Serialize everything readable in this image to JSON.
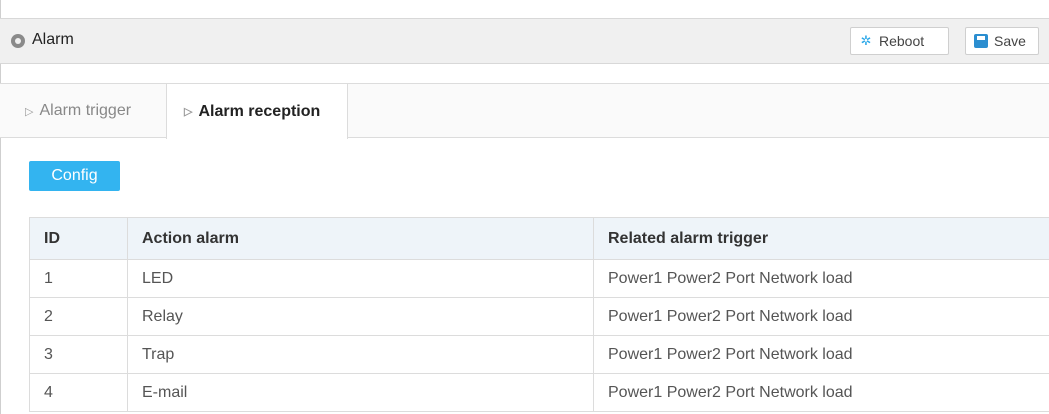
{
  "header": {
    "title": "Alarm",
    "reboot_label": "Reboot",
    "save_label": "Save"
  },
  "tabs": [
    {
      "label": "Alarm trigger",
      "active": false
    },
    {
      "label": "Alarm reception",
      "active": true
    }
  ],
  "config_label": "Config",
  "table": {
    "columns": [
      "ID",
      "Action alarm",
      "Related alarm trigger"
    ],
    "rows": [
      {
        "id": "1",
        "action": "LED",
        "trigger": "Power1 Power2 Port Network load"
      },
      {
        "id": "2",
        "action": "Relay",
        "trigger": "Power1 Power2 Port Network load"
      },
      {
        "id": "3",
        "action": "Trap",
        "trigger": "Power1 Power2 Port Network load"
      },
      {
        "id": "4",
        "action": "E-mail",
        "trigger": "Power1 Power2 Port Network load"
      }
    ]
  },
  "colors": {
    "accent": "#33b4f0",
    "header_bg": "#f0f0f0",
    "table_head_bg": "#eef4f9"
  }
}
